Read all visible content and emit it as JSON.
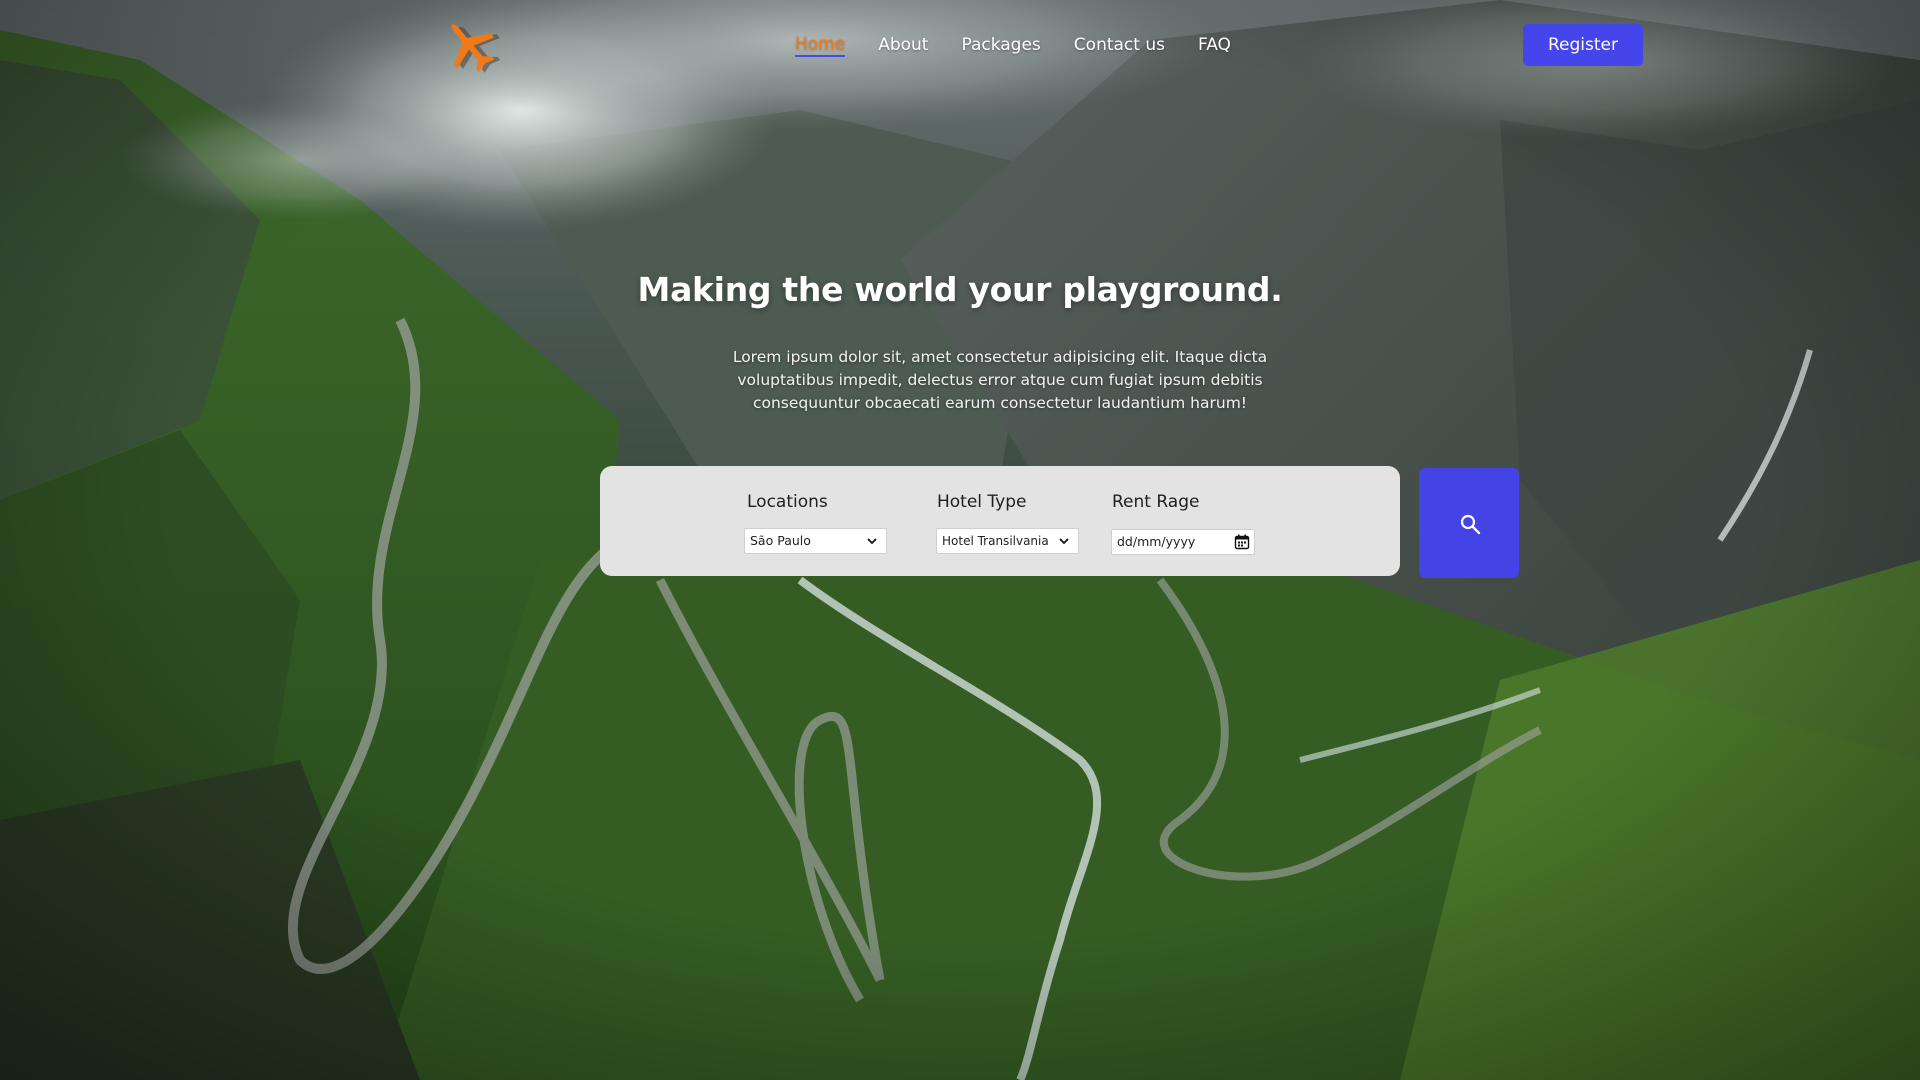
{
  "nav": {
    "items": [
      {
        "label": "Home",
        "active": true
      },
      {
        "label": "About",
        "active": false
      },
      {
        "label": "Packages",
        "active": false
      },
      {
        "label": "Contact us",
        "active": false
      },
      {
        "label": "FAQ",
        "active": false
      }
    ],
    "register_label": "Register"
  },
  "logo": {
    "icon": "airplane-icon",
    "color": "#f07a1a"
  },
  "hero": {
    "title": "Making the world your playground.",
    "text": "Lorem ipsum dolor sit, amet consectetur adipisicing elit. Itaque dicta voluptatibus impedit, delectus error atque cum fugiat ipsum debitis consequuntur obcaecati earum consectetur laudantium harum!"
  },
  "search": {
    "location": {
      "label": "Locations",
      "value": "São Paulo"
    },
    "hotel_type": {
      "label": "Hotel Type",
      "value": "Hotel Transilvania"
    },
    "rent_range": {
      "label": "Rent Rage",
      "placeholder": "dd/mm/yyyy"
    },
    "button_icon": "search-icon"
  },
  "colors": {
    "accent": "#4545ec",
    "active_link": "#f07a1a",
    "panel": "#e3e3e3"
  }
}
